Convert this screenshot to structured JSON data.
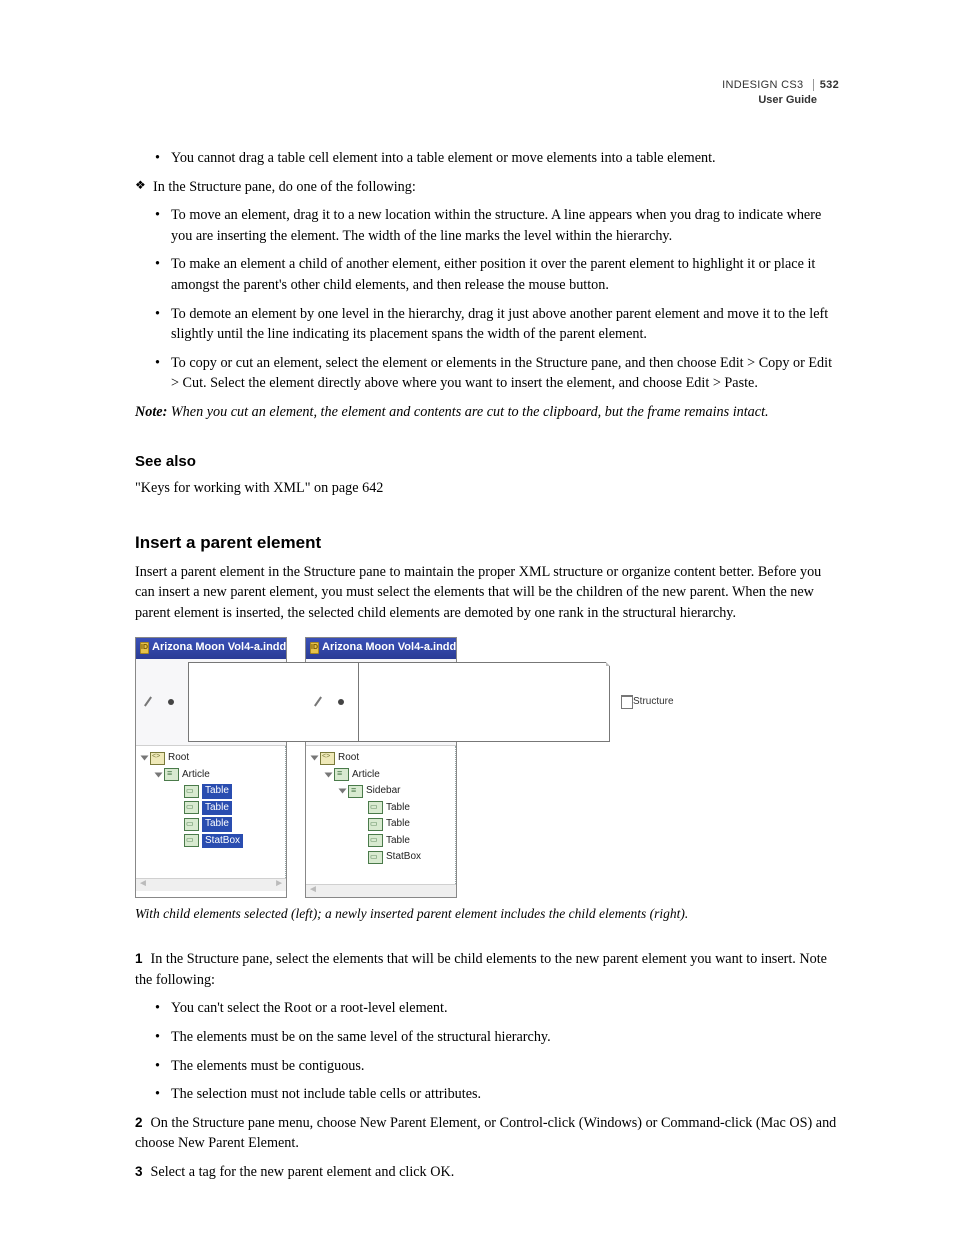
{
  "header": {
    "product": "INDESIGN CS3",
    "guide": "User Guide",
    "page": "532"
  },
  "top_bullets": [
    "You cannot drag a table cell element into a table element or move elements into a table element."
  ],
  "instruction": "In the Structure pane, do one of the following:",
  "sub_bullets": [
    "To move an element, drag it to a new location within the structure. A line appears when you drag to indicate where you are inserting the element. The width of the line marks the level within the hierarchy.",
    "To make an element a child of another element, either position it over the parent element to highlight it or place it amongst the parent's other child elements, and then release the mouse button.",
    "To demote an element by one level in the hierarchy, drag it just above another parent element and move it to the left slightly until the line indicating its placement spans the width of the parent element.",
    "To copy or cut an element, select the element or elements in the Structure pane, and then choose Edit > Copy or Edit > Cut. Select the element directly above where you want to insert the element, and choose Edit > Paste."
  ],
  "note": {
    "label": "Note:",
    "text": "When you cut an element, the element and contents are cut to the clipboard, but the frame remains intact."
  },
  "see_also": {
    "heading": "See also",
    "xref": "\"Keys for working with XML\" on page 642"
  },
  "section": {
    "heading": "Insert a parent element",
    "intro": "Insert a parent element in the Structure pane to maintain the proper XML structure or organize content better. Before you can insert a new parent element, you must select the elements that will be the children of the new parent. When the new parent element is inserted, the selected child elements are demoted by one rank in the structural hierarchy."
  },
  "figure": {
    "pane_title": "Arizona Moon Vol4-a.indd",
    "tab": "Structure",
    "left": {
      "root": "Root",
      "article": "Article",
      "items": [
        {
          "label": "Table",
          "selected": true
        },
        {
          "label": "Table",
          "selected": true
        },
        {
          "label": "Table",
          "selected": true
        },
        {
          "label": "StatBox",
          "selected": true
        }
      ]
    },
    "right": {
      "root": "Root",
      "article": "Article",
      "sidebar": "Sidebar",
      "items": [
        {
          "label": "Table"
        },
        {
          "label": "Table"
        },
        {
          "label": "Table"
        },
        {
          "label": "StatBox"
        }
      ]
    },
    "caption": "With child elements selected (left); a newly inserted parent element includes the child elements (right)."
  },
  "steps": {
    "s1": {
      "n": "1",
      "text": "In the Structure pane, select the elements that will be child elements to the new parent element you want to insert. Note the following:"
    },
    "s1_bullets": [
      "You can't select the Root or a root-level element.",
      "The elements must be on the same level of the structural hierarchy.",
      "The elements must be contiguous.",
      "The selection must not include table cells or attributes."
    ],
    "s2": {
      "n": "2",
      "text": "On the Structure pane menu, choose New Parent Element, or Control-click (Windows) or Command-click (Mac OS) and choose New Parent Element."
    },
    "s3": {
      "n": "3",
      "text": "Select a tag for the new parent element and click OK."
    }
  }
}
